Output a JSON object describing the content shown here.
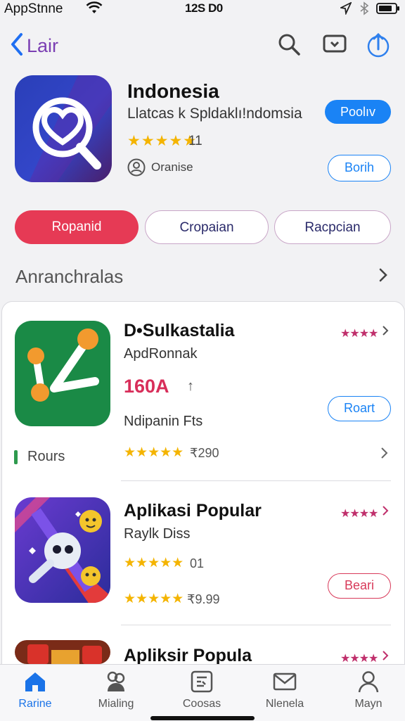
{
  "status_bar": {
    "carrier": "AppStnne",
    "time": "12S D0"
  },
  "nav": {
    "back_label": "Lair"
  },
  "featured": {
    "title": "Indonesia",
    "subtitle": "Llatcas k Spldaklı!ndomsia",
    "rating_stars": "★★★★★",
    "rating_count": "11",
    "developer": "Oranise",
    "primary_button": "Poolıv",
    "secondary_button": "Borih"
  },
  "filters": [
    {
      "label": "Ropanid"
    },
    {
      "label": "Cropaian"
    },
    {
      "label": "Racpcian"
    }
  ],
  "section": {
    "title": "Anranchralas"
  },
  "apps": [
    {
      "title": "D•Sulkastalia",
      "subtitle": "ApdRonnak",
      "price": "160A",
      "price_suffix": "↑",
      "note": "Ndipanin Fts",
      "tag": "Rours",
      "mini_stars": "★★★★",
      "button": "Roart",
      "stars": "★★★★★",
      "stars_value": "₹290"
    },
    {
      "title": "Aplikasi Popular",
      "subtitle": "Raylk Diss",
      "mini_stars": "★★★★",
      "stars_a": "★★★★★",
      "stars_a_value": "01",
      "button": "Beari",
      "stars_b": "★★★★★",
      "stars_b_value": "₹9.99"
    },
    {
      "title": "Apliksir Popula",
      "mini_stars": "★★★★"
    }
  ],
  "tabs": [
    {
      "label": "Rarine",
      "icon": "home-icon",
      "active": true
    },
    {
      "label": "Mialing",
      "icon": "games-icon"
    },
    {
      "label": "Coosas",
      "icon": "apps-icon"
    },
    {
      "label": "Nlenela",
      "icon": "mail-icon"
    },
    {
      "label": "Mayn",
      "icon": "person-icon"
    }
  ],
  "colors": {
    "accent": "#1a83f5",
    "active_pill": "#e63a55",
    "price": "#d82e5a",
    "star_gold": "#f4b400"
  }
}
